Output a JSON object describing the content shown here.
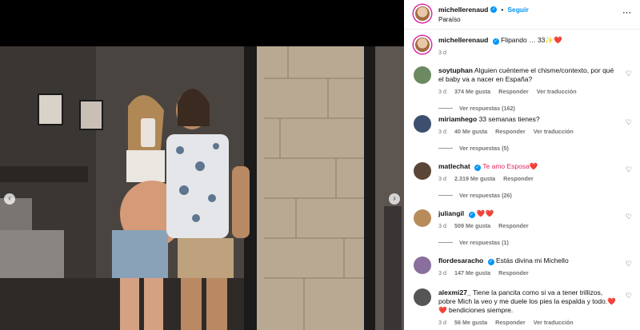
{
  "header": {
    "username": "michellerenaud",
    "follow_label": "Seguir",
    "separator": "•",
    "location": "Paraíso",
    "more_icon": "⋯"
  },
  "caption": {
    "username": "michellerenaud",
    "text": "Flipando … 33✨❤️",
    "time": "3 d"
  },
  "comments": [
    {
      "username": "soytuphan",
      "text": "Alguien cuénteme el chisme/contexto, por qué el baby va a nacer en España?",
      "time": "3 d",
      "likes": "374 Me gusta",
      "reply": "Responder",
      "translate": "Ver traducción",
      "replies": "Ver respuestas (162)",
      "avatar_color": "#6b8a62"
    },
    {
      "username": "miriamhego",
      "text": "33 semanas tienes?",
      "time": "3 d",
      "likes": "40 Me gusta",
      "reply": "Responder",
      "translate": "Ver traducción",
      "replies": "Ver respuestas (5)",
      "avatar_color": "#3d4f6e"
    },
    {
      "username": "matlechat",
      "text": "Te amo Esposa❤️",
      "time": "3 d",
      "likes": "2.319 Me gusta",
      "reply": "Responder",
      "translate": "",
      "replies": "Ver respuestas (26)",
      "avatar_color": "#5b4636"
    },
    {
      "username": "juliangil",
      "text": "❤️❤️",
      "time": "3 d",
      "likes": "509 Me gusta",
      "reply": "Responder",
      "translate": "",
      "replies": "Ver respuestas (1)",
      "avatar_color": "#b88c5a"
    },
    {
      "username": "flordesaracho",
      "text": "Estás divina mi Michello",
      "time": "3 d",
      "likes": "147 Me gusta",
      "reply": "Responder",
      "translate": "",
      "replies": "",
      "avatar_color": "#8a6f9e"
    },
    {
      "username": "alexmi27_",
      "text": "Tiene la pancita como si va a tener trillizos, pobre Mich la veo y me duele los pies la espalda y todo.❤️❤️ bendiciones siempre.",
      "time": "3 d",
      "likes": "56 Me gusta",
      "reply": "Responder",
      "translate": "Ver traducción",
      "replies": "",
      "avatar_color": "#555555"
    }
  ],
  "icons": {
    "heart": "heart-outline-icon",
    "verified": "verified-badge-icon",
    "prev": "chevron-left-icon",
    "next": "chevron-right-icon"
  }
}
